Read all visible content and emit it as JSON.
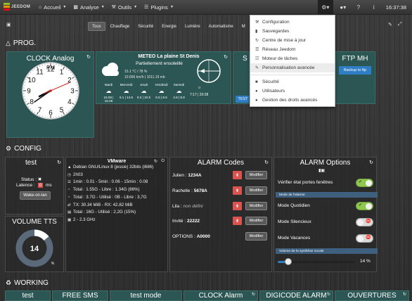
{
  "navbar": {
    "logo_text": "JEEDOM",
    "items": [
      {
        "label": "Accueil",
        "icon": "home-icon"
      },
      {
        "label": "Analyse",
        "icon": "chart-icon"
      },
      {
        "label": "Outils",
        "icon": "wrench-icon"
      },
      {
        "label": "Plugins",
        "icon": "tasks-icon"
      }
    ],
    "time": "16:37:38"
  },
  "settings_menu": {
    "items": [
      {
        "label": "Configuration",
        "icon": "wrench-icon"
      },
      {
        "label": "Sauvegardes",
        "icon": "folder-icon"
      },
      {
        "label": "Centre de mise à jour",
        "icon": "refresh-icon"
      },
      {
        "label": "Réseau Jeedom",
        "icon": "list-icon"
      },
      {
        "label": "Moteur de tâches",
        "icon": "tasks-icon"
      },
      {
        "label": "Personnalisation avancée",
        "icon": "edit-icon"
      },
      {
        "label": "Sécurité",
        "icon": "lock-icon"
      },
      {
        "label": "Utilisateurs",
        "icon": "user-icon"
      },
      {
        "label": "Gestion des droits avancés",
        "icon": "users-icon"
      }
    ]
  },
  "filters": [
    "Tous",
    "Chauffage",
    "Sécurité",
    "Energie",
    "Lumière",
    "Automatisme",
    "M"
  ],
  "prog": {
    "title": "PROG.",
    "clock": {
      "title": "CLOCK Analog",
      "pm": "PM",
      "hours": [
        "12",
        "1",
        "2",
        "3",
        "4",
        "5",
        "6",
        "7",
        "8",
        "9",
        "10",
        "11"
      ]
    },
    "meteo": {
      "title": "METEO La plaine St Denis",
      "condition": "Partiellement ensoleillé",
      "line1": "15.1 °C / 78 %",
      "line2": "10.666 km/h | 1011.19 mb",
      "days": [
        {
          "name": "Mardi",
          "temp": "15.06 | 15.06"
        },
        {
          "name": "Mercredi",
          "temp": "6.1 | 14.5"
        },
        {
          "name": "Jeudi",
          "temp": "6.3 | 10.5"
        },
        {
          "name": "Vendredi",
          "temp": "6.5 | 8.5"
        },
        {
          "name": "Samedi",
          "temp": "4.8 | 8.8"
        }
      ],
      "sun_times": "7:17 | 20:28"
    },
    "partial_tile": {
      "title": "S",
      "button": "TEST"
    },
    "ftp": {
      "title": "FTP MH",
      "button": "Backup to ftp"
    }
  },
  "config": {
    "title": "CONFIG",
    "test": {
      "title": "test",
      "status_label": "Status :",
      "latency_label": "Latence :",
      "latency_value": "0",
      "latency_unit": "ms",
      "button": "Wake-on-lan"
    },
    "volume": {
      "title": "VOLUME TTS",
      "value": "14",
      "unit": "%",
      "level": 0.14
    },
    "vmware": {
      "title": "VMware",
      "lines": [
        {
          "icon": "linux-icon",
          "text": "Debian GNU/Linux 8 (jessie) 32bits (i686)"
        },
        {
          "icon": "clock-icon",
          "text": "2h03"
        },
        {
          "icon": "tasks-icon",
          "text": "1min : 0.01 - 5min : 0.06 - 15min : 0.08"
        },
        {
          "icon": "pie-icon",
          "text": "Total : 1.55G - Libre : 1.34G (86%)"
        },
        {
          "icon": "pie-icon",
          "text": "Total : 3.7G - Utilisé : 0B - Libre : 3,7G"
        },
        {
          "icon": "exchange-icon",
          "text": "TX: 30.34 MiB - RX: 42.82 MiB"
        },
        {
          "icon": "hdd-icon",
          "text": "Total : 16G - Utilisé : 2,2G (15%)"
        },
        {
          "icon": "cpu-icon",
          "text": "2 - 2.3 GHz"
        }
      ]
    },
    "alarm_codes": {
      "title": "ALARM Codes",
      "rows": [
        {
          "name": "Julien :",
          "code": "1234A",
          "defined": true
        },
        {
          "name": "Rachelle :",
          "code": "5678A",
          "defined": true
        },
        {
          "name": "Lila :",
          "code": "non défini",
          "defined": false
        },
        {
          "name": "Invité :",
          "code": "22222",
          "defined": true
        },
        {
          "name": "OPTIONS :",
          "code": "A0000",
          "defined": true
        }
      ],
      "modify_label": "Modifier"
    },
    "alarm_options": {
      "title": "ALARM Options",
      "doors_label": "Vérifier état portes fenêtres",
      "mode_band": "Mode de l'alarme",
      "modes": [
        {
          "label": "Mode Quotidien",
          "on": true
        },
        {
          "label": "Mode Silencieux",
          "on": false
        },
        {
          "label": "Mode Vacances",
          "on": false
        }
      ],
      "volume_band": "Volume de la synthèse vocale",
      "volume_value": "14 %",
      "volume_level": 0.14
    }
  },
  "working": {
    "title": "WORKING",
    "tabs": [
      "test",
      "FREE SMS",
      "test mode",
      "CLOCK Alarm",
      "DIGICODE ALARM",
      "OUVERTURES"
    ]
  }
}
